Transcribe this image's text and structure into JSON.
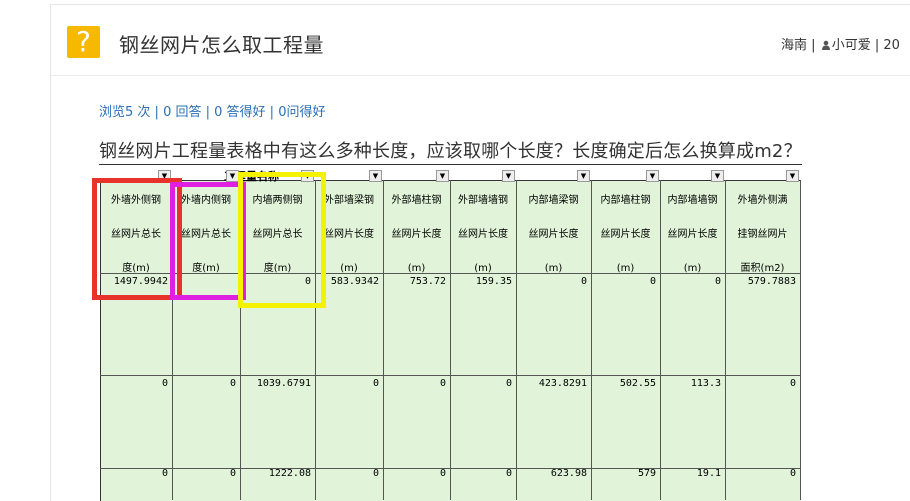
{
  "header": {
    "icon": "question-mark-icon",
    "icon_glyph": "?",
    "title": "钢丝网片怎么取工程量",
    "location": "海南",
    "separator": "|",
    "user_icon": "user-icon",
    "username": "小可爱",
    "date_prefix": "| 20"
  },
  "stats": {
    "views": "浏览5 次",
    "sep1": " | ",
    "answers": "0 回答",
    "sep2": " | ",
    "good_answers": "0 答得好",
    "sep3": " | ",
    "ask_good": "0问得好"
  },
  "question": "钢丝网片工程量表格中有这么多种长度，应该取哪个长度？长度确定后怎么换算成m2？",
  "sheet": {
    "group_title": "工程量名称",
    "headers": [
      [
        "外墙外侧钢",
        "丝网片总长",
        "度(m)"
      ],
      [
        "外墙内侧钢",
        "丝网片总长",
        "度(m)"
      ],
      [
        "内墙两侧钢",
        "丝网片总长",
        "度(m)"
      ],
      [
        "外部墙梁钢",
        "丝网片长度",
        "(m)"
      ],
      [
        "外部墙柱钢",
        "丝网片长度",
        "(m)"
      ],
      [
        "外部墙墙钢",
        "丝网片长度",
        "(m)"
      ],
      [
        "内部墙梁钢",
        "丝网片长度",
        "(m)"
      ],
      [
        "内部墙柱钢",
        "丝网片长度",
        "(m)"
      ],
      [
        "内部墙墙钢",
        "丝网片长度",
        "(m)"
      ],
      [
        "外墙外侧满",
        "挂钢丝网片",
        "面积(m2)"
      ]
    ],
    "rows": [
      [
        "1497.9942",
        "",
        "0",
        "583.9342",
        "753.72",
        "159.35",
        "0",
        "0",
        "0",
        "579.7883"
      ],
      [
        "0",
        "0",
        "1039.6791",
        "0",
        "0",
        "0",
        "423.8291",
        "502.55",
        "113.3",
        "0"
      ],
      [
        "0",
        "0",
        "1222.08",
        "0",
        "0",
        "0",
        "623.98",
        "579",
        "19.1",
        "0"
      ]
    ],
    "highlight_colors": [
      "#e8322c",
      "#e020e0",
      "#f5f200"
    ]
  }
}
